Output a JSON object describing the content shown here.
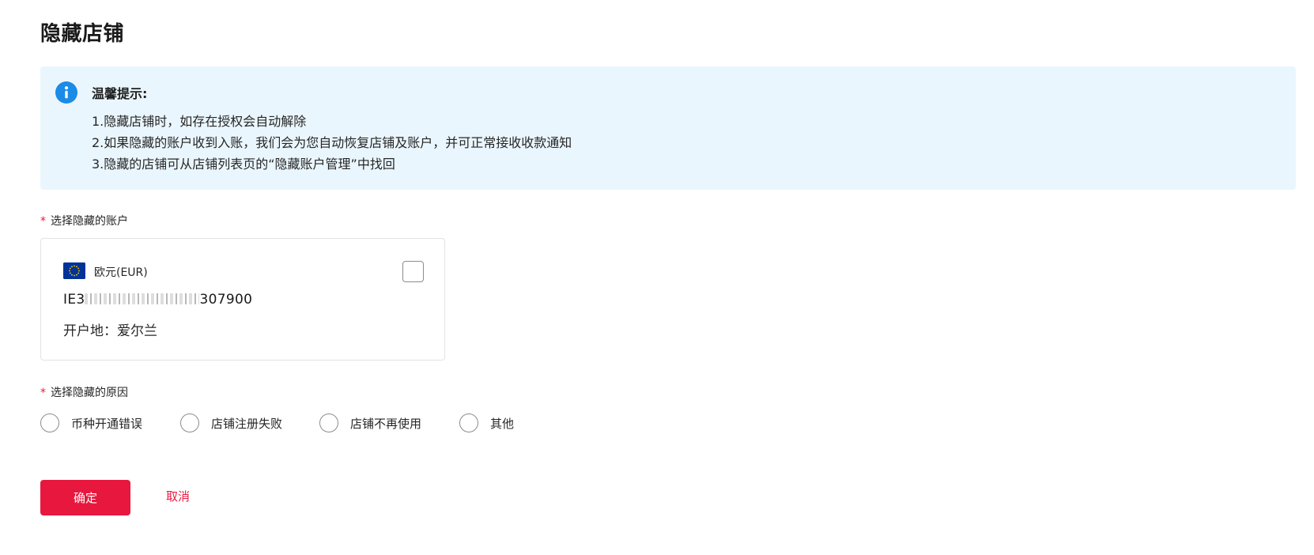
{
  "page": {
    "title": "隐藏店铺"
  },
  "notice": {
    "icon": "info-icon",
    "title": "温馨提示:",
    "lines": [
      "1.隐藏店铺时，如存在授权会自动解除",
      "2.如果隐藏的账户收到入账，我们会为您自动恢复店铺及账户，并可正常接收收款通知",
      "3.隐藏的店铺可从店铺列表页的“隐藏账户管理”中找回"
    ],
    "background": "#eaf6fd",
    "icon_color": "#1a8be6"
  },
  "account_section": {
    "required_mark": "*",
    "label": "选择隐藏的账户",
    "account": {
      "flag_icon": "eu-flag-icon",
      "currency": "欧元(EUR)",
      "iban_prefix": "IE3",
      "iban_suffix": "307900",
      "location": "开户地：爱尔兰",
      "checked": false
    }
  },
  "reason_section": {
    "required_mark": "*",
    "label": "选择隐藏的原因",
    "options": [
      "币种开通错误",
      "店铺注册失败",
      "店铺不再使用",
      "其他"
    ]
  },
  "actions": {
    "confirm": "确定",
    "cancel": "取消",
    "accent": "#e8173e"
  }
}
